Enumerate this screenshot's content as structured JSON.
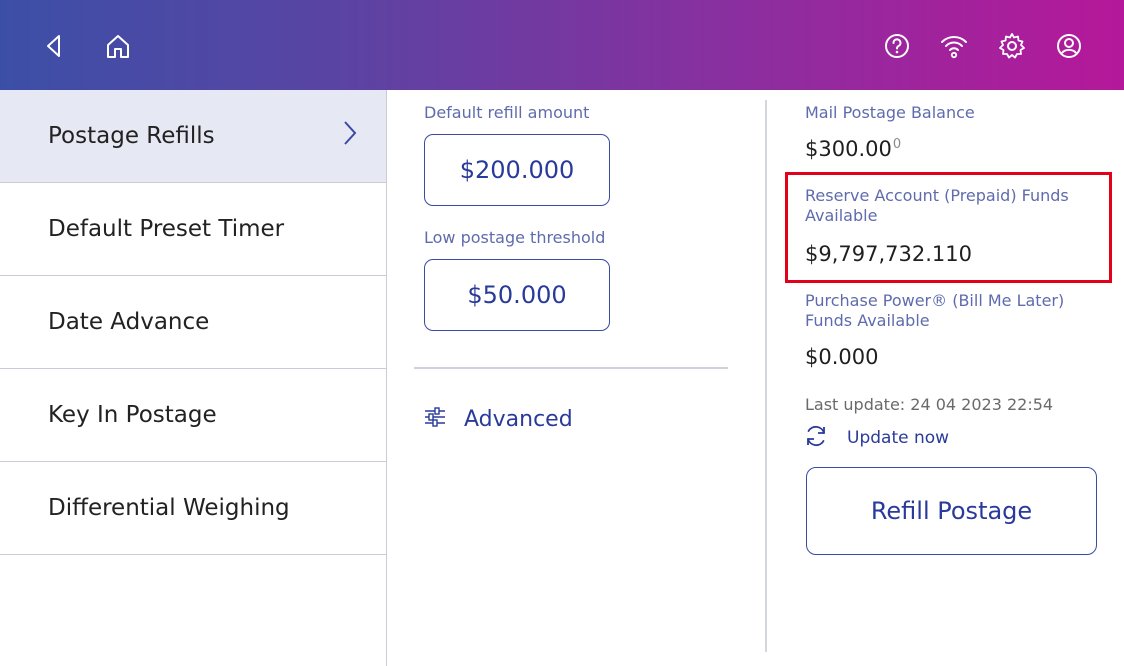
{
  "header": {
    "icons": [
      "back-icon",
      "home-icon",
      "help-icon",
      "wifi-icon",
      "settings-icon",
      "account-icon"
    ],
    "gradient": [
      "#3c4fa6",
      "#8a2f9f",
      "#b5189a"
    ]
  },
  "sidebar": {
    "items": [
      {
        "label": "Postage Refills",
        "active": true
      },
      {
        "label": "Default Preset Timer"
      },
      {
        "label": "Date Advance"
      },
      {
        "label": "Key In Postage"
      },
      {
        "label": "Differential Weighing"
      }
    ]
  },
  "refills": {
    "default_label": "Default refill amount",
    "default_value": "$200.000",
    "threshold_label": "Low postage threshold",
    "threshold_value": "$50.000",
    "advanced_label": "Advanced"
  },
  "funds": {
    "mail_balance_label": "Mail Postage Balance",
    "mail_balance_value": "$300.00",
    "mail_balance_suffix": "0",
    "reserve_label": "Reserve Account (Prepaid) Funds Available",
    "reserve_value": "$9,797,732.110",
    "purchase_power_label": "Purchase Power® (Bill Me Later) Funds Available",
    "purchase_power_value": "$0.000",
    "last_update": "Last update: 24 04 2023 22:54",
    "update_now_label": "Update now",
    "refill_button_label": "Refill Postage",
    "highlight_color": "#e2001a",
    "accent_color": "#2a3a9a"
  }
}
